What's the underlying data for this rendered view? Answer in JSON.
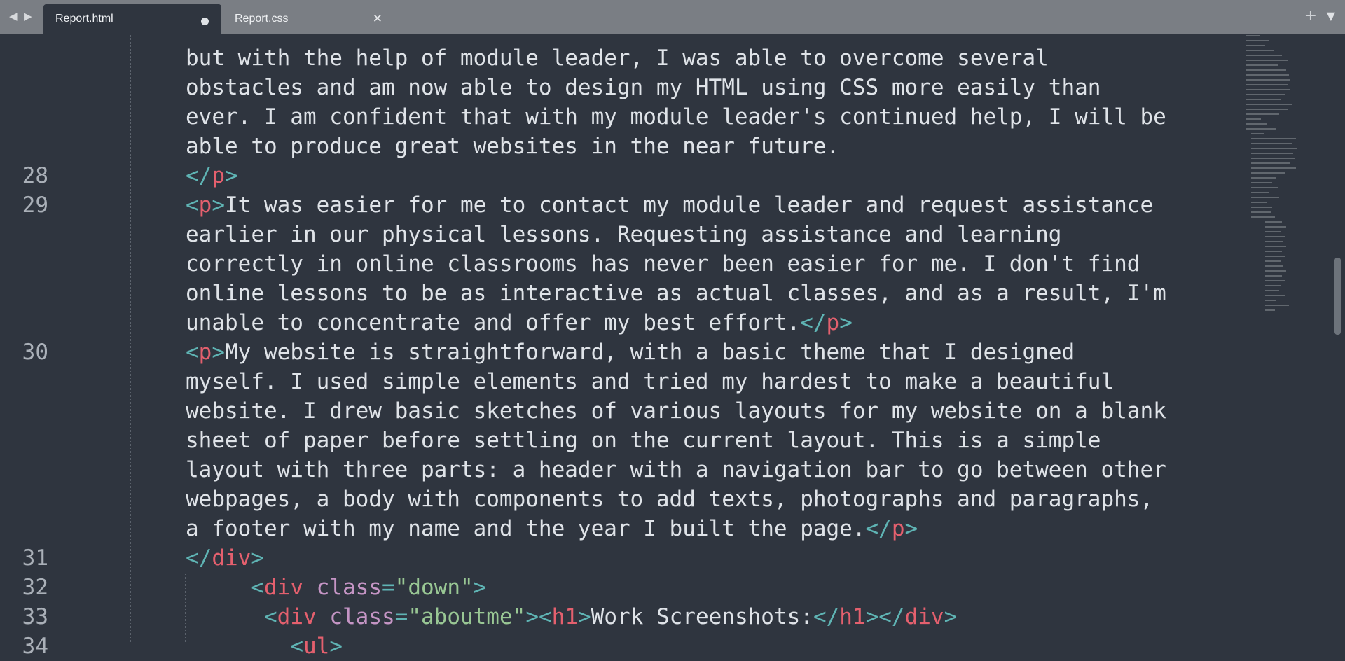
{
  "tabs": [
    {
      "label": "Report.html",
      "active": true,
      "modified": true
    },
    {
      "label": "Report.css",
      "active": false,
      "modified": false
    }
  ],
  "toolbar": {
    "back_icon": "chevron-left-icon",
    "forward_icon": "chevron-right-icon",
    "new_tab_icon": "plus-icon",
    "menu_icon": "chevron-down-icon"
  },
  "colors": {
    "background": "#2f353f",
    "tag": "#e4606e",
    "punct": "#5fb4b4",
    "attr": "#c595c5",
    "string": "#99c794",
    "text": "#dfe3e8"
  },
  "editor": {
    "lines": [
      {
        "num": "",
        "text": "but with the help of module leader, I was able to overcome several"
      },
      {
        "num": "",
        "text": "obstacles and am now able to design my HTML using CSS more easily than"
      },
      {
        "num": "",
        "text": "ever. I am confident that with my module leader's continued help, I will be"
      },
      {
        "num": "",
        "text": "able to produce great websites in the near future."
      },
      {
        "num": "28",
        "close_tag": "p"
      },
      {
        "num": "29",
        "open_tag": "p",
        "text": "It was easier for me to contact my module leader and request assistance"
      },
      {
        "num": "",
        "text": "earlier in our physical lessons. Requesting assistance and learning"
      },
      {
        "num": "",
        "text": "correctly in online classrooms has never been easier for me. I don't find"
      },
      {
        "num": "",
        "text": "online lessons to be as interactive as actual classes, and as a result, I'm"
      },
      {
        "num": "",
        "text": "unable to concentrate and offer my best effort.",
        "close_tag": "p"
      },
      {
        "num": "30",
        "open_tag": "p",
        "text": "My website is straightforward, with a basic theme that I designed"
      },
      {
        "num": "",
        "text": "myself. I used simple elements and tried my hardest to make a beautiful"
      },
      {
        "num": "",
        "text": "website. I drew basic sketches of various layouts for my website on a blank"
      },
      {
        "num": "",
        "text": "sheet of paper before settling on the current layout. This is a simple"
      },
      {
        "num": "",
        "text": "layout with three parts: a header with a navigation bar to go between other"
      },
      {
        "num": "",
        "text": "webpages, a body with components to add texts, photographs and paragraphs,"
      },
      {
        "num": "",
        "text": "a footer with my name and the year I built the page.",
        "close_tag": "p"
      },
      {
        "num": "31",
        "close_tag": "div"
      },
      {
        "num": "32",
        "indent": "     ",
        "tag": "div",
        "attr": "class",
        "value": "down"
      },
      {
        "num": "33",
        "indent": "      ",
        "tag": "div",
        "attr": "class",
        "value": "aboutme",
        "inner_tag": "h1",
        "inner_text": "Work Screenshots:"
      },
      {
        "num": "34",
        "indent": "        ",
        "tag": "ul"
      }
    ]
  }
}
